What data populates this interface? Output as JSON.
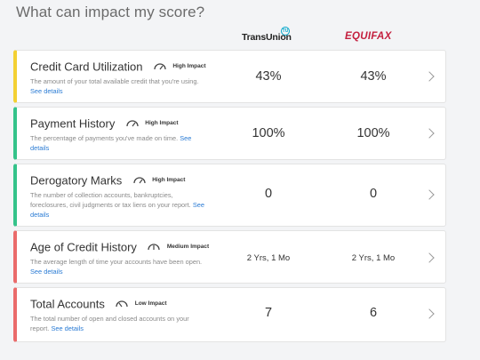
{
  "heading": "What can impact my score?",
  "bureaus": {
    "transunion": "TransUnion",
    "transunion_badge": "TU",
    "equifax": "EQUIFAX"
  },
  "colors": {
    "yellow": "#f3d033",
    "green": "#34c38a",
    "red": "#ea6b6b",
    "link": "#2a7bd4"
  },
  "factors": [
    {
      "title": "Credit Card Utilization",
      "impact": "High Impact",
      "impact_icon": "gauge-icon",
      "desc": "The amount of your total available credit that you're using.",
      "link": "See details",
      "transunion": "43%",
      "equifax": "43%",
      "status_color": "yellow"
    },
    {
      "title": "Payment History",
      "impact": "High Impact",
      "impact_icon": "gauge-icon",
      "desc": "The percentage of payments you've made on time.",
      "link": "See details",
      "transunion": "100%",
      "equifax": "100%",
      "status_color": "green"
    },
    {
      "title": "Derogatory Marks",
      "impact": "High Impact",
      "impact_icon": "gauge-icon",
      "desc": "The number of collection accounts, bankruptcies, foreclosures, civil judgments or tax liens on your report.",
      "link": "See details",
      "transunion": "0",
      "equifax": "0",
      "status_color": "green"
    },
    {
      "title": "Age of Credit History",
      "impact": "Medium Impact",
      "impact_icon": "gauge-icon",
      "desc": "The average length of time your accounts have been open.",
      "link": "See details",
      "transunion": "2 Yrs, 1 Mo",
      "equifax": "2 Yrs, 1 Mo",
      "status_color": "red"
    },
    {
      "title": "Total Accounts",
      "impact": "Low Impact",
      "impact_icon": "gauge-icon",
      "desc": "The total number of open and closed accounts on your report.",
      "link": "See details",
      "transunion": "7",
      "equifax": "6",
      "status_color": "red"
    }
  ]
}
